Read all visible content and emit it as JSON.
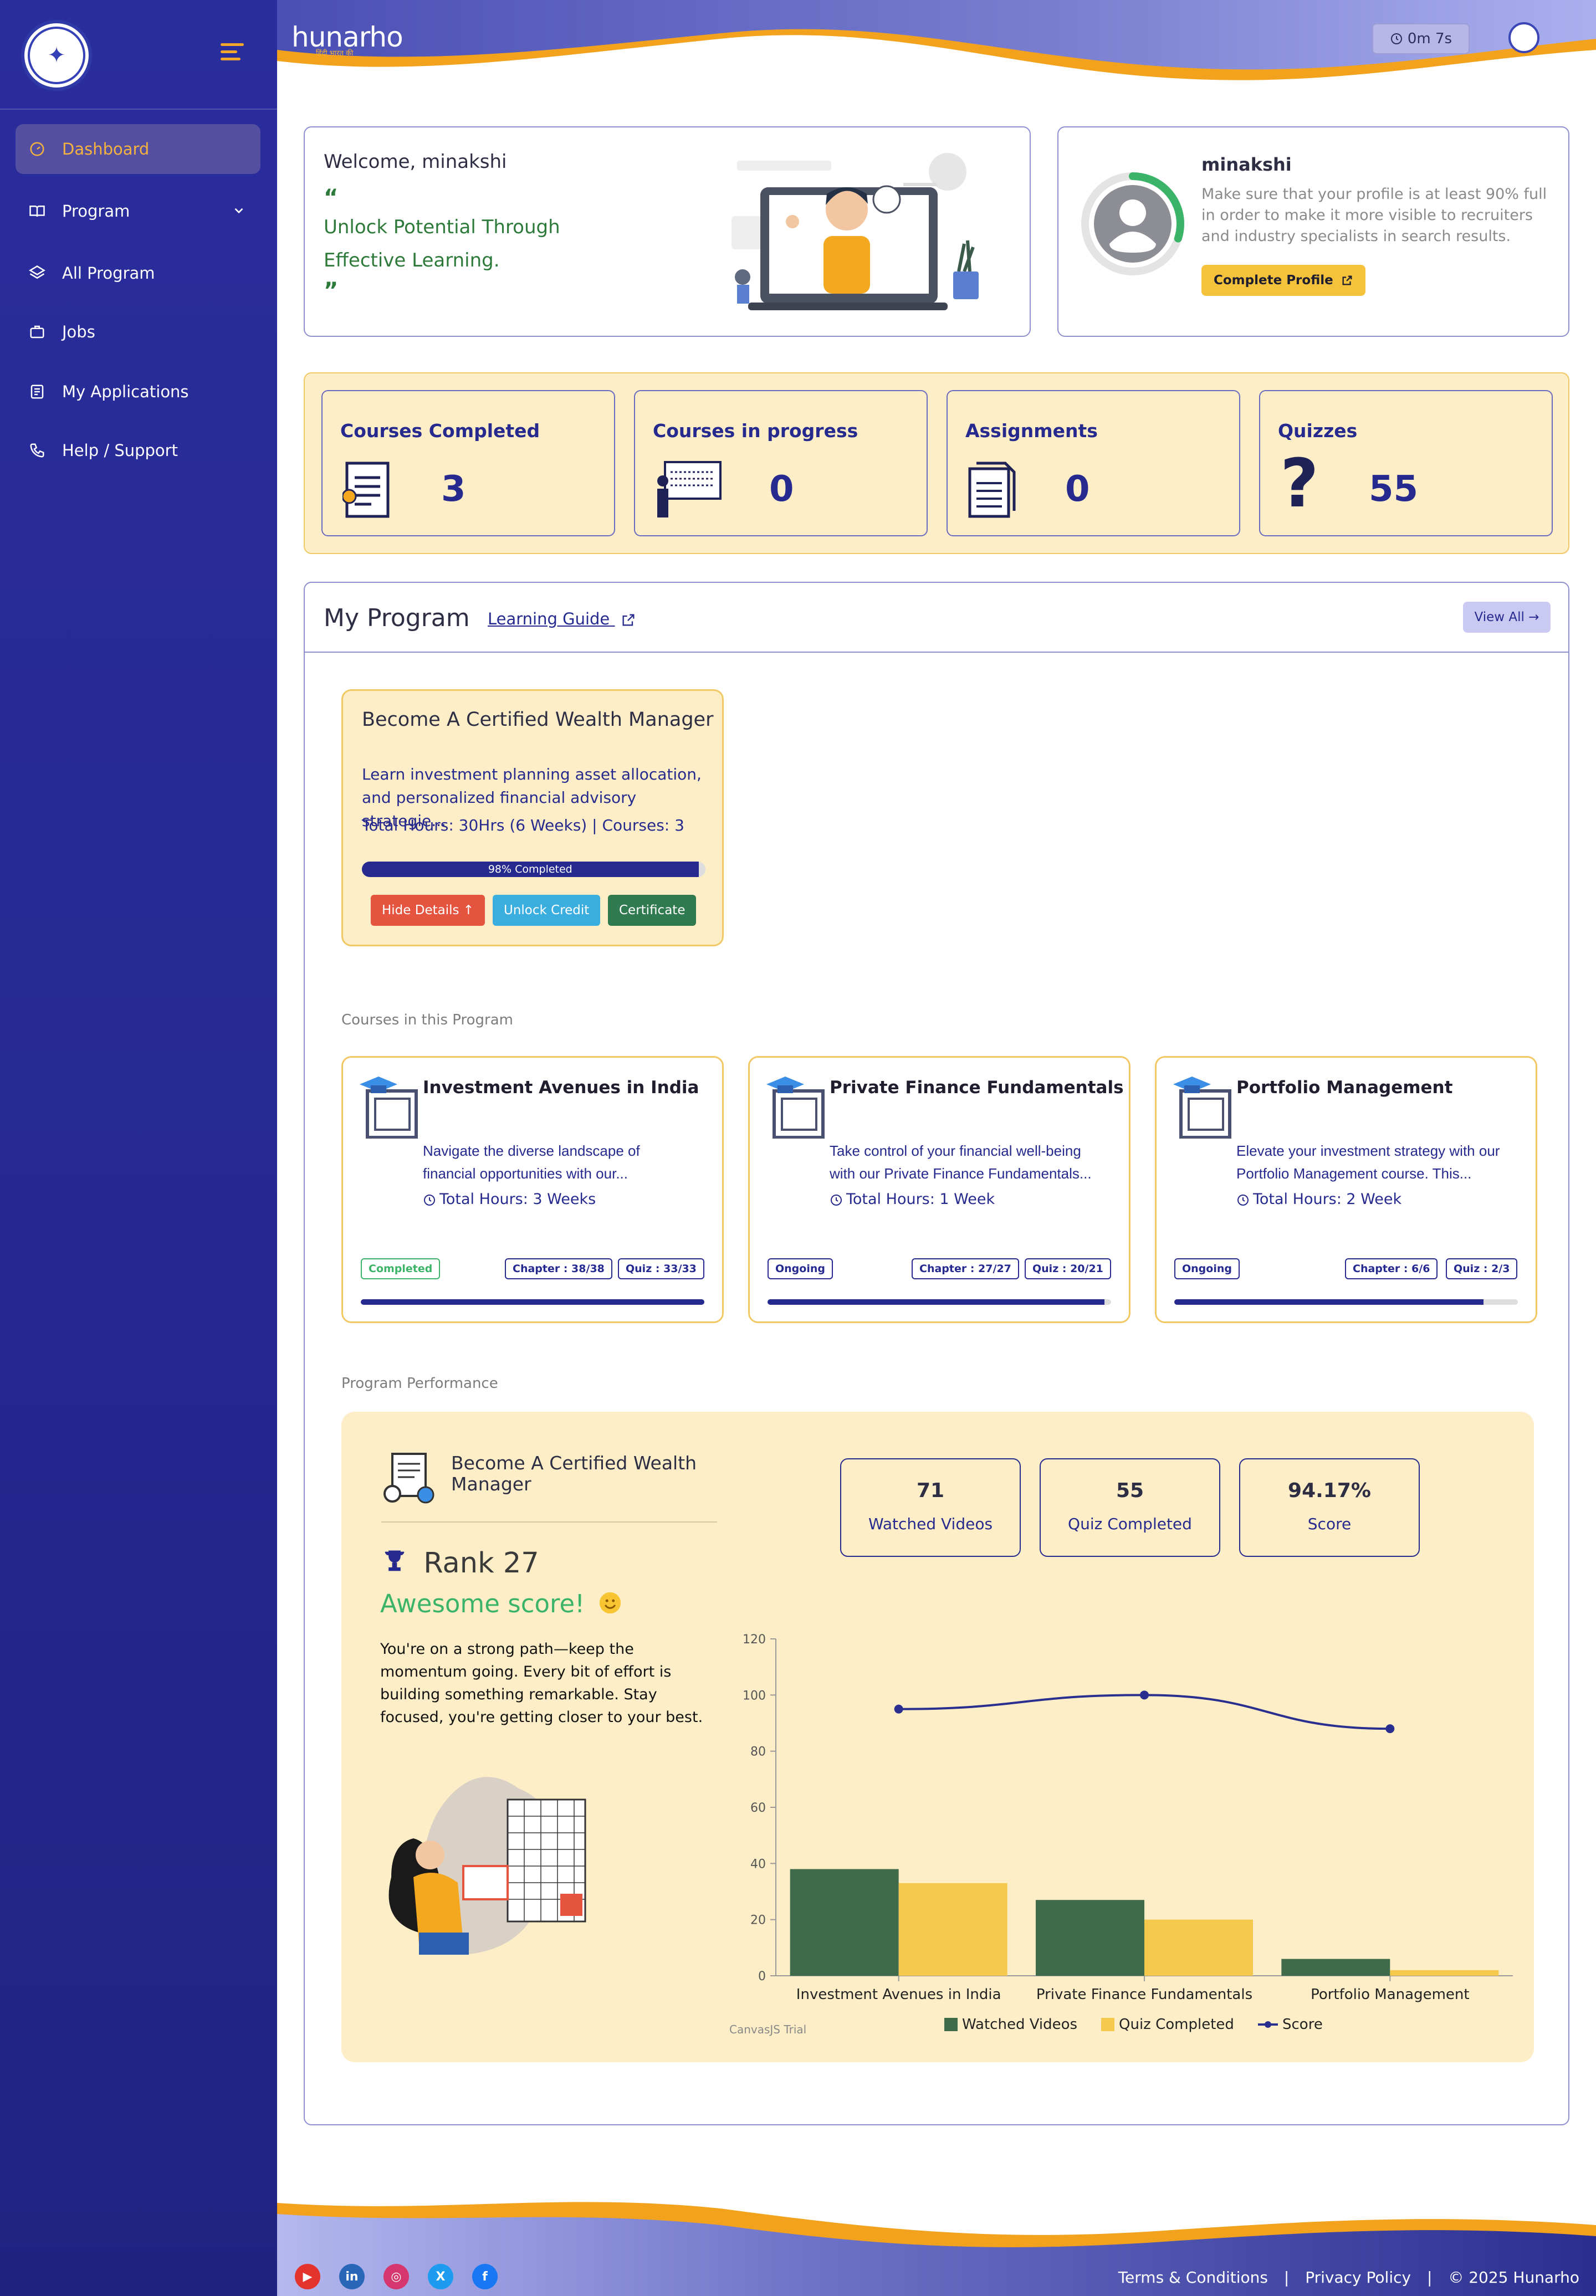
{
  "sidebar": {
    "items": [
      {
        "label": "Dashboard",
        "icon": "gauge-icon"
      },
      {
        "label": "Program",
        "icon": "book-open-icon"
      },
      {
        "label": "All Program",
        "icon": "layers-icon"
      },
      {
        "label": "Jobs",
        "icon": "briefcase-icon"
      },
      {
        "label": "My Applications",
        "icon": "clipboard-list-icon"
      },
      {
        "label": "Help / Support",
        "icon": "phone-icon"
      }
    ]
  },
  "header": {
    "brand": "hunarho",
    "brand_tagline": "हिंदी भारत की",
    "timer": "0m 7s"
  },
  "welcome": {
    "greeting": "Welcome, minakshi",
    "open_quote": "“",
    "line1": "Unlock Potential Through",
    "line2": "Effective Learning.",
    "close_quote": "”"
  },
  "profile": {
    "name": "minakshi",
    "message": "Make sure that your profile is at least 90% full in order to make it more visible to recruiters and industry specialists in search results.",
    "button": "Complete Profile",
    "completion": 0.3
  },
  "stats": [
    {
      "label": "Courses Completed",
      "value": "3",
      "icon": "certificate-icon"
    },
    {
      "label": "Courses in progress",
      "value": "0",
      "icon": "presentation-icon"
    },
    {
      "label": "Assignments",
      "value": "0",
      "icon": "documents-icon"
    },
    {
      "label": "Quizzes",
      "value": "55",
      "icon": "question-icon"
    }
  ],
  "program": {
    "title": "My Program",
    "guide": "Learning Guide",
    "view_all": "View All →",
    "card": {
      "title": "Become A Certified Wealth Manager",
      "desc1": "Learn investment planning asset allocation,",
      "desc2": "and personalized financial advisory strategie...",
      "hours": "Total Hours: 30Hrs (6 Weeks) | Courses: 3",
      "progress_label": "98% Completed",
      "progress": 98,
      "btn_hide": "Hide Details ↑",
      "btn_unlock": "Unlock Credit",
      "btn_cert": "Certificate"
    }
  },
  "courses_label": "Courses in this Program",
  "courses": [
    {
      "title": "Investment Avenues in India",
      "desc1": "Navigate the diverse landscape of",
      "desc2": "financial opportunities with our...",
      "hours": "Total Hours: 3 Weeks",
      "status": "Completed",
      "chapter": "Chapter : 38/38",
      "quiz": "Quiz : 33/33",
      "progress": 100
    },
    {
      "title": "Private Finance Fundamentals",
      "desc1": "Take control of your financial well-being",
      "desc2": "with our Private Finance Fundamentals...",
      "hours": "Total Hours: 1 Week",
      "status": "Ongoing",
      "chapter": "Chapter : 27/27",
      "quiz": "Quiz : 20/21",
      "progress": 98
    },
    {
      "title": "Portfolio Management",
      "desc1": "Elevate your investment strategy with our",
      "desc2": "Portfolio Management course. This...",
      "hours": "Total Hours: 2 Week",
      "status": "Ongoing",
      "chapter": "Chapter : 6/6",
      "quiz": "Quiz : 2/3",
      "progress": 90
    }
  ],
  "performance": {
    "label": "Program Performance",
    "program_title": "Become A Certified Wealth Manager",
    "rank": "Rank 27",
    "awesome": "Awesome score!",
    "message": "You're on a strong path—keep the momentum going. Every bit of effort is building something remarkable. Stay focused, you're getting closer to your best.",
    "kpis": [
      {
        "value": "71",
        "label": "Watched Videos"
      },
      {
        "value": "55",
        "label": "Quiz Completed"
      },
      {
        "value": "94.17%",
        "label": "Score"
      }
    ],
    "watermark": "CanvasJS Trial"
  },
  "chart_data": {
    "type": "bar",
    "categories": [
      "Investment Avenues in India",
      "Private Finance Fundamentals",
      "Portfolio Management"
    ],
    "series": [
      {
        "name": "Watched Videos",
        "type": "bar",
        "values": [
          38,
          27,
          6
        ],
        "color": "#3f6b4a"
      },
      {
        "name": "Quiz Completed",
        "type": "bar",
        "values": [
          33,
          20,
          2
        ],
        "color": "#f5c84e"
      },
      {
        "name": "Score",
        "type": "line",
        "values": [
          95,
          100,
          88
        ],
        "color": "#2a2e8f"
      }
    ],
    "ylim": [
      0,
      120
    ],
    "yticks": [
      "0",
      "20",
      "40",
      "60",
      "80",
      "100",
      "120"
    ],
    "legend": "bottom"
  },
  "footer": {
    "terms": "Terms & Conditions",
    "privacy": "Privacy Policy",
    "copyright": "© 2025 Hunarho",
    "sep": "|",
    "socials": [
      "youtube-icon",
      "linkedin-icon",
      "instagram-icon",
      "x-icon",
      "facebook-icon"
    ]
  }
}
